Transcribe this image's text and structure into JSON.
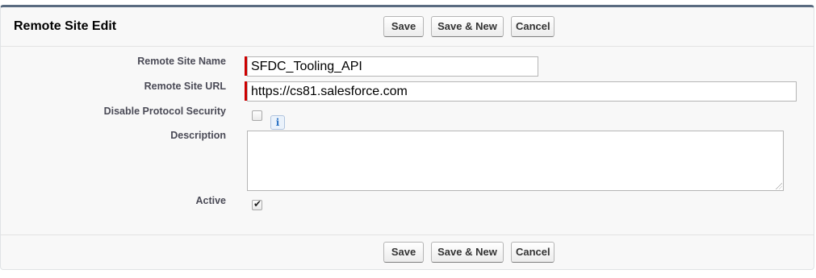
{
  "header": {
    "title": "Remote Site Edit"
  },
  "buttons": {
    "save": "Save",
    "save_new": "Save & New",
    "cancel": "Cancel"
  },
  "form": {
    "remote_site_name": {
      "label": "Remote Site Name",
      "value": "SFDC_Tooling_API",
      "required": true
    },
    "remote_site_url": {
      "label": "Remote Site URL",
      "value": "https://cs81.salesforce.com",
      "required": true
    },
    "disable_protocol_security": {
      "label": "Disable Protocol Security",
      "checked": false,
      "info_icon": "i"
    },
    "description": {
      "label": "Description",
      "value": ""
    },
    "active": {
      "label": "Active",
      "checked": true
    }
  },
  "colors": {
    "required_bar": "#cc0000",
    "header_border": "#5a6b80"
  }
}
